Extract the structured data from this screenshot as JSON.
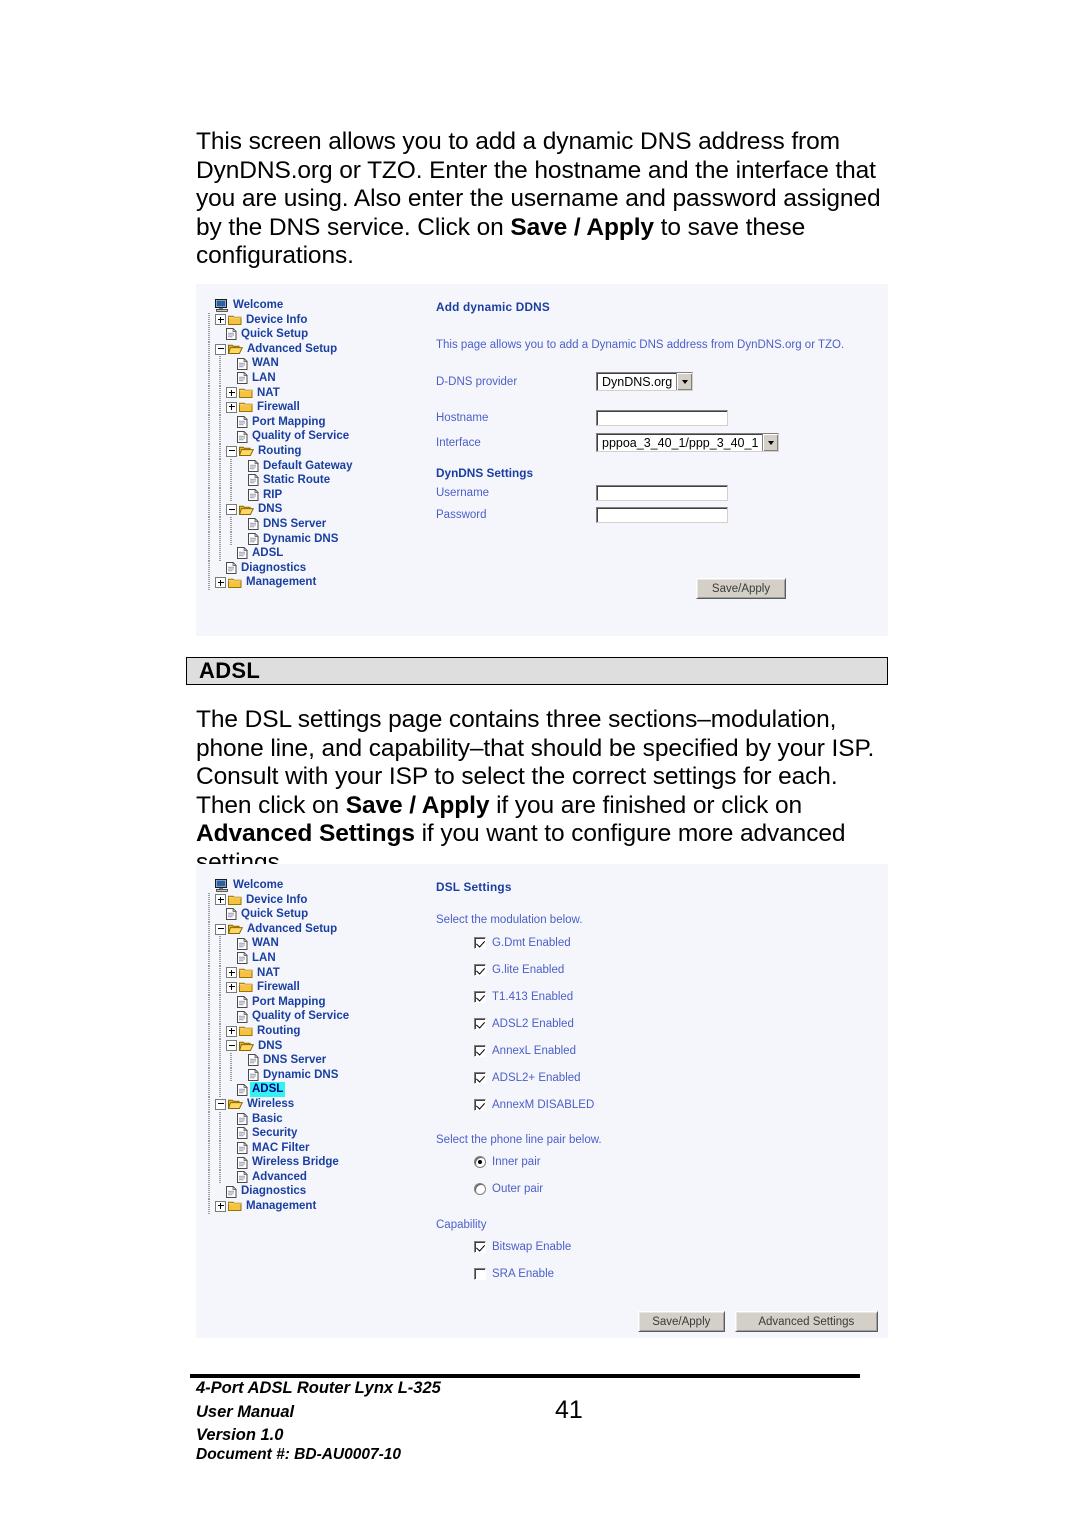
{
  "document": {
    "paragraphs": {
      "intro_pre": "This screen allows you to add a dynamic DNS address from DynDNS.org or TZO.  Enter the hostname and the interface that you are using.  Also enter the username and password assigned by the DNS service.  Click on ",
      "intro_bold": "Save / Apply",
      "intro_post": " to save these configurations.",
      "adsl_pre": "The DSL settings page contains three sections–modulation, phone line, and capability–that should be specified by your ISP.  Consult with your ISP to select the correct settings for each.  Then click on ",
      "adsl_bold1": "Save / Apply",
      "adsl_mid": " if you are finished or click on ",
      "adsl_bold2": "Advanced Settings",
      "adsl_post": " if you want to configure more advanced settings."
    },
    "section_heading": "ADSL",
    "footer": {
      "line1": "4-Port ADSL Router Lynx L-325",
      "line2": "User Manual",
      "line3": "Version 1.0",
      "line4": "Document #:  BD-AU0007-10",
      "page_number": "41"
    }
  },
  "ddns_screenshot": {
    "tree": [
      {
        "label": "Welcome",
        "icon": "computer-icon",
        "indent": 0,
        "toggle": "none",
        "selected": false
      },
      {
        "label": "Device Info",
        "icon": "folder-closed-icon",
        "indent": 1,
        "toggle": "plus",
        "selected": false
      },
      {
        "label": "Quick Setup",
        "icon": "page-icon",
        "indent": 1,
        "toggle": "none",
        "selected": false
      },
      {
        "label": "Advanced Setup",
        "icon": "folder-open-icon",
        "indent": 1,
        "toggle": "minus",
        "selected": false
      },
      {
        "label": "WAN",
        "icon": "page-icon",
        "indent": 2,
        "toggle": "none",
        "selected": false
      },
      {
        "label": "LAN",
        "icon": "page-icon",
        "indent": 2,
        "toggle": "none",
        "selected": false
      },
      {
        "label": "NAT",
        "icon": "folder-closed-icon",
        "indent": 2,
        "toggle": "plus",
        "selected": false
      },
      {
        "label": "Firewall",
        "icon": "folder-closed-icon",
        "indent": 2,
        "toggle": "plus",
        "selected": false
      },
      {
        "label": "Port Mapping",
        "icon": "page-icon",
        "indent": 2,
        "toggle": "none",
        "selected": false
      },
      {
        "label": "Quality of Service",
        "icon": "page-icon",
        "indent": 2,
        "toggle": "none",
        "selected": false
      },
      {
        "label": "Routing",
        "icon": "folder-open-icon",
        "indent": 2,
        "toggle": "minus",
        "selected": false
      },
      {
        "label": "Default Gateway",
        "icon": "page-icon",
        "indent": 3,
        "toggle": "none",
        "selected": false
      },
      {
        "label": "Static Route",
        "icon": "page-icon",
        "indent": 3,
        "toggle": "none",
        "selected": false
      },
      {
        "label": "RIP",
        "icon": "page-icon",
        "indent": 3,
        "toggle": "none",
        "selected": false
      },
      {
        "label": "DNS",
        "icon": "folder-open-icon",
        "indent": 2,
        "toggle": "minus",
        "selected": false
      },
      {
        "label": "DNS Server",
        "icon": "page-icon",
        "indent": 3,
        "toggle": "none",
        "selected": false
      },
      {
        "label": "Dynamic DNS",
        "icon": "page-icon",
        "indent": 3,
        "toggle": "none",
        "selected": false
      },
      {
        "label": "ADSL",
        "icon": "page-icon",
        "indent": 2,
        "toggle": "none",
        "selected": false
      },
      {
        "label": "Diagnostics",
        "icon": "page-icon",
        "indent": 1,
        "toggle": "none",
        "selected": false
      },
      {
        "label": "Management",
        "icon": "folder-closed-icon",
        "indent": 1,
        "toggle": "plus",
        "selected": false
      }
    ],
    "title": "Add dynamic DDNS",
    "description": "This page allows you to add a Dynamic DNS address from DynDNS.org or TZO.",
    "fields": {
      "provider_label": "D-DNS provider",
      "provider_value": "DynDNS.org",
      "hostname_label": "Hostname",
      "hostname_value": "",
      "interface_label": "Interface",
      "interface_value": "pppoa_3_40_1/ppp_3_40_1"
    },
    "dyndns_settings_title": "DynDNS Settings",
    "username_label": "Username",
    "username_value": "",
    "password_label": "Password",
    "password_value": "",
    "save_button": "Save/Apply"
  },
  "dsl_screenshot": {
    "tree": [
      {
        "label": "Welcome",
        "icon": "computer-icon",
        "indent": 0,
        "toggle": "none",
        "selected": false
      },
      {
        "label": "Device Info",
        "icon": "folder-closed-icon",
        "indent": 1,
        "toggle": "plus",
        "selected": false
      },
      {
        "label": "Quick Setup",
        "icon": "page-icon",
        "indent": 1,
        "toggle": "none",
        "selected": false
      },
      {
        "label": "Advanced Setup",
        "icon": "folder-open-icon",
        "indent": 1,
        "toggle": "minus",
        "selected": false
      },
      {
        "label": "WAN",
        "icon": "page-icon",
        "indent": 2,
        "toggle": "none",
        "selected": false
      },
      {
        "label": "LAN",
        "icon": "page-icon",
        "indent": 2,
        "toggle": "none",
        "selected": false
      },
      {
        "label": "NAT",
        "icon": "folder-closed-icon",
        "indent": 2,
        "toggle": "plus",
        "selected": false
      },
      {
        "label": "Firewall",
        "icon": "folder-closed-icon",
        "indent": 2,
        "toggle": "plus",
        "selected": false
      },
      {
        "label": "Port Mapping",
        "icon": "page-icon",
        "indent": 2,
        "toggle": "none",
        "selected": false
      },
      {
        "label": "Quality of Service",
        "icon": "page-icon",
        "indent": 2,
        "toggle": "none",
        "selected": false
      },
      {
        "label": "Routing",
        "icon": "folder-closed-icon",
        "indent": 2,
        "toggle": "plus",
        "selected": false
      },
      {
        "label": "DNS",
        "icon": "folder-open-icon",
        "indent": 2,
        "toggle": "minus",
        "selected": false
      },
      {
        "label": "DNS Server",
        "icon": "page-icon",
        "indent": 3,
        "toggle": "none",
        "selected": false
      },
      {
        "label": "Dynamic DNS",
        "icon": "page-icon",
        "indent": 3,
        "toggle": "none",
        "selected": false
      },
      {
        "label": "ADSL",
        "icon": "page-icon",
        "indent": 2,
        "toggle": "none",
        "selected": true
      },
      {
        "label": "Wireless",
        "icon": "folder-open-icon",
        "indent": 1,
        "toggle": "minus",
        "selected": false
      },
      {
        "label": "Basic",
        "icon": "page-icon",
        "indent": 2,
        "toggle": "none",
        "selected": false
      },
      {
        "label": "Security",
        "icon": "page-icon",
        "indent": 2,
        "toggle": "none",
        "selected": false
      },
      {
        "label": "MAC Filter",
        "icon": "page-icon",
        "indent": 2,
        "toggle": "none",
        "selected": false
      },
      {
        "label": "Wireless Bridge",
        "icon": "page-icon",
        "indent": 2,
        "toggle": "none",
        "selected": false
      },
      {
        "label": "Advanced",
        "icon": "page-icon",
        "indent": 2,
        "toggle": "none",
        "selected": false
      },
      {
        "label": "Diagnostics",
        "icon": "page-icon",
        "indent": 1,
        "toggle": "none",
        "selected": false
      },
      {
        "label": "Management",
        "icon": "folder-closed-icon",
        "indent": 1,
        "toggle": "plus",
        "selected": false
      }
    ],
    "title": "DSL Settings",
    "modulation_prompt": "Select the modulation below.",
    "modulation_options": [
      {
        "label": "G.Dmt Enabled",
        "checked": true
      },
      {
        "label": "G.lite Enabled",
        "checked": true
      },
      {
        "label": "T1.413 Enabled",
        "checked": true
      },
      {
        "label": "ADSL2 Enabled",
        "checked": true
      },
      {
        "label": "AnnexL Enabled",
        "checked": true
      },
      {
        "label": "ADSL2+ Enabled",
        "checked": true
      },
      {
        "label": "AnnexM DISABLED",
        "checked": true
      }
    ],
    "phone_line_prompt": "Select the phone line pair below.",
    "phone_line_options": [
      {
        "label": "Inner pair",
        "selected": true
      },
      {
        "label": "Outer pair",
        "selected": false
      }
    ],
    "capability_label": "Capability",
    "capability_options": [
      {
        "label": "Bitswap Enable",
        "checked": true
      },
      {
        "label": "SRA Enable",
        "checked": false
      }
    ],
    "save_button": "Save/Apply",
    "advanced_button": "Advanced Settings"
  },
  "colors": {
    "panel_background": "#f5f6fc",
    "tree_link": "#1a3fa0",
    "panel_text": "#4a5fc8",
    "selection_highlight": "#33f2f2",
    "heading_bar": "#dedede",
    "button_face": "#d4d0c8"
  }
}
